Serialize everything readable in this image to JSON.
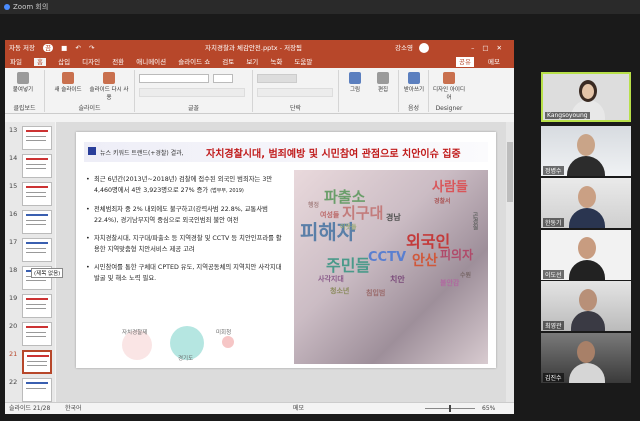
{
  "zoom": {
    "title": "Zoom 회의"
  },
  "ppt": {
    "autosave_label": "자동 저장",
    "autosave_state": "끔",
    "doc_title": "자치경찰과 체감안전.pptx - 저장됨",
    "user_name": "강소영",
    "tabs": [
      "파일",
      "홈",
      "삽입",
      "디자인",
      "전환",
      "애니메이션",
      "슬라이드 쇼",
      "검토",
      "보기",
      "녹화",
      "도움말"
    ],
    "active_tab": "홈",
    "share_label": "공유",
    "memo_label": "메모",
    "ribbon": {
      "paste": "붙여넣기",
      "new_slide": "새 슬라이드",
      "reuse_slide": "슬라이드 다시 사용",
      "picture": "그림",
      "edit": "편집",
      "dictate": "받아쓰기",
      "designer": "디자인 아이디어",
      "groups": [
        "클립보드",
        "슬라이드",
        "글꼴",
        "단락",
        "음성",
        "Designer"
      ]
    },
    "thumbnails": [
      {
        "num": "13"
      },
      {
        "num": "14"
      },
      {
        "num": "15"
      },
      {
        "num": "16"
      },
      {
        "num": "17"
      },
      {
        "num": "18"
      },
      {
        "num": "19"
      },
      {
        "num": "20"
      },
      {
        "num": "21"
      },
      {
        "num": "22"
      }
    ],
    "thumb_tooltip": "(제목 없음)",
    "slide": {
      "prefix": "뉴스 키워드 트랜드(+경찰) 결과,",
      "headline": "자치경찰시대, 범죄예방 및 시민참여 관점으로 치안이슈 집중",
      "bullets": [
        "최근 6년간(2013년~2018년) 검찰에 접수된 외국인 범죄자는 3만 4,460명에서 4만 3,923명으로 27% 증가",
        "전체범죄자 중 2% 내외에도 불구하고(강력사범 22.8%, 교통사범 22.4%), 경기남부지역 중심으로 외국인범죄 불안 여전",
        "자치경찰시대, 지구대/파출소 등 지역경찰 및 CCTV 등 치안인프라를 활용한 지역맞춤형 치안서비스 제공 고려",
        "시민참여를 통한 구체대 CPTED 유도, 지역공동체의 지역치안 사각지대 발굴 및 해소 노력 필요."
      ],
      "source_note": "(법무부, 2019)",
      "venn_labels": [
        "자치경찰제",
        "경기도",
        "미회청"
      ],
      "wordcloud": [
        "사람들",
        "파출소",
        "지구대",
        "경찰서",
        "여성들",
        "피해자",
        "경남",
        "외국인",
        "주민들",
        "CCTV",
        "안산",
        "피의자",
        "사각지대",
        "치안",
        "불안감",
        "청소년",
        "침입범",
        "곤경질",
        "수원",
        "이웃들",
        "행정"
      ]
    },
    "status": {
      "slide_info": "슬라이드 21/28",
      "language": "한국어",
      "notes": "메모",
      "zoom": "65%"
    }
  },
  "participants": [
    {
      "name": "Kangsoyoung",
      "active": true
    },
    {
      "name": "정병수",
      "active": false
    },
    {
      "name": "한동기",
      "active": false
    },
    {
      "name": "이도선",
      "active": false
    },
    {
      "name": "최영관",
      "active": false
    },
    {
      "name": "김진수",
      "active": false
    }
  ],
  "colors": {
    "accent": "#b7472a",
    "headline": "#c01a1a",
    "speaker_border": "#b8e04a"
  }
}
